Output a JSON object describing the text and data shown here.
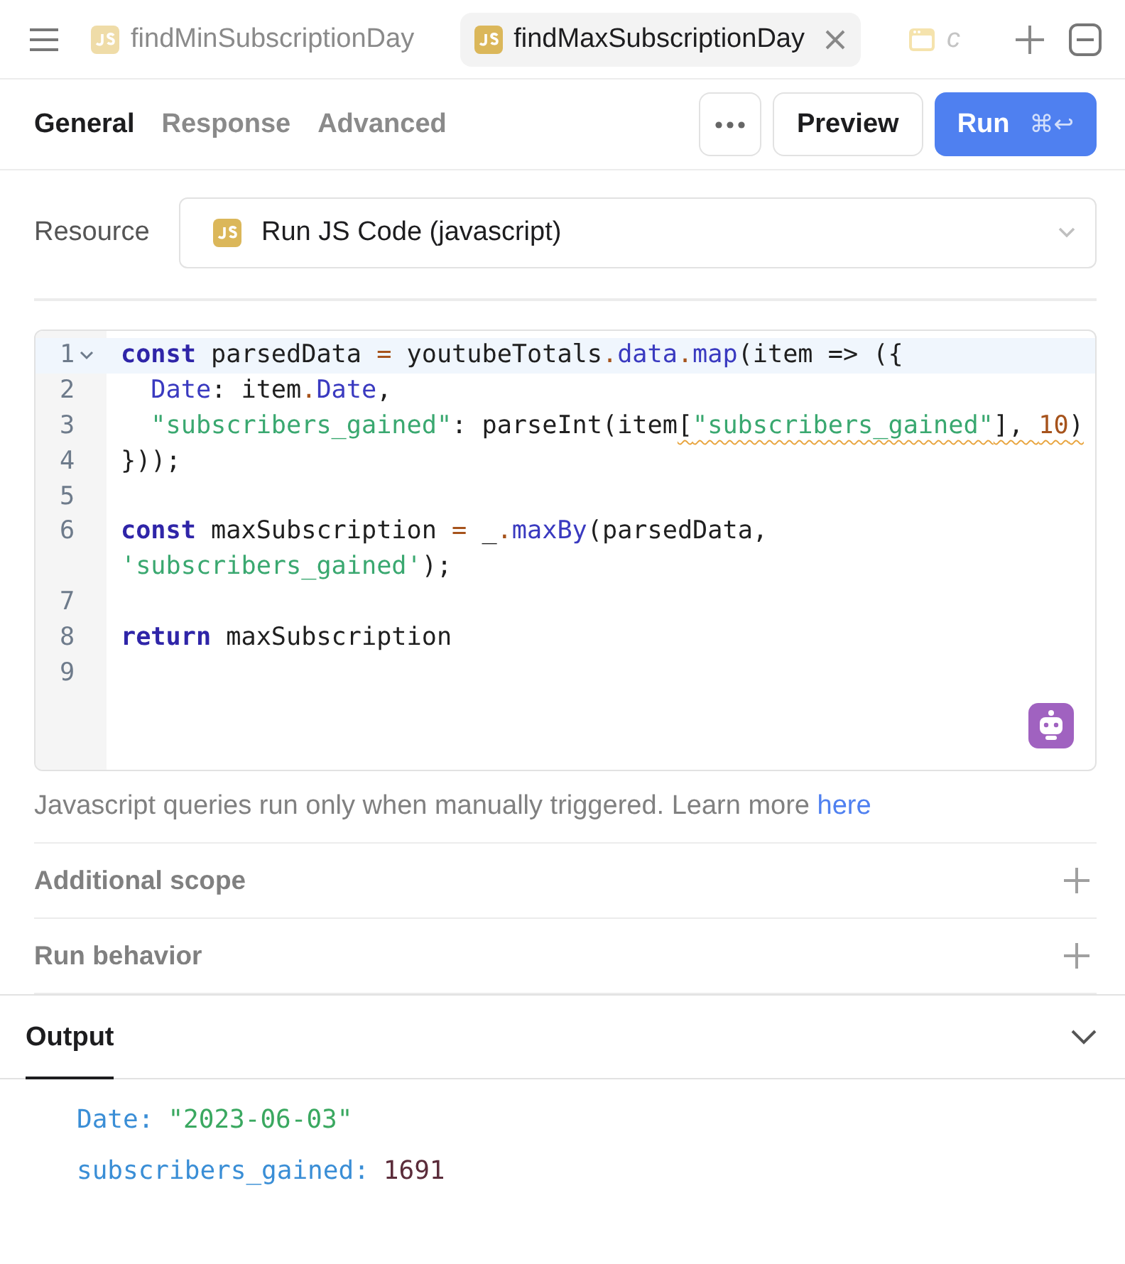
{
  "file_tabs": [
    {
      "label": "findMinSubscriptionDay",
      "kind": "js",
      "selected": false,
      "closable": false,
      "faded": false
    },
    {
      "label": "findMaxSubscriptionDay",
      "kind": "js",
      "selected": true,
      "closable": true,
      "faded": false
    },
    {
      "label": "c",
      "kind": "app",
      "selected": false,
      "closable": false,
      "faded": true
    }
  ],
  "section_tabs": [
    {
      "label": "General",
      "selected": true
    },
    {
      "label": "Response",
      "selected": false
    },
    {
      "label": "Advanced",
      "selected": false
    }
  ],
  "actions": {
    "preview": "Preview",
    "run": "Run",
    "run_shortcut": "⌘↩"
  },
  "resource": {
    "label": "Resource",
    "value": "Run JS Code (javascript)"
  },
  "code_lines": [
    {
      "number": "1",
      "active": true,
      "foldable": true,
      "rows": [
        [
          {
            "t": "const",
            "kind": "kw"
          },
          {
            "t": " parsedData ",
            "kind": "plain"
          },
          {
            "t": "=",
            "kind": "op"
          },
          {
            "t": " youtubeTotals",
            "kind": "plain"
          },
          {
            "t": ".",
            "kind": "op"
          },
          {
            "t": "data",
            "kind": "prop"
          },
          {
            "t": ".",
            "kind": "op"
          },
          {
            "t": "map",
            "kind": "prop"
          },
          {
            "t": "(item => ({",
            "kind": "plain"
          }
        ]
      ]
    },
    {
      "number": "2",
      "active": false,
      "foldable": false,
      "rows": [
        [
          {
            "t": "  Date",
            "kind": "prop"
          },
          {
            "t": ": item",
            "kind": "plain"
          },
          {
            "t": ".",
            "kind": "op"
          },
          {
            "t": "Date",
            "kind": "prop"
          },
          {
            "t": ",",
            "kind": "plain"
          }
        ]
      ]
    },
    {
      "number": "3",
      "active": false,
      "foldable": false,
      "rows": [
        [
          {
            "t": "  \"subscribers_gained\"",
            "kind": "str"
          },
          {
            "t": ": parseInt(item",
            "kind": "plain"
          },
          {
            "t": "[",
            "kind": "plain",
            "warning": true
          },
          {
            "t": "\"subscribers_gained\"",
            "kind": "str",
            "warning": true
          },
          {
            "t": "], ",
            "kind": "plain",
            "warning": true
          },
          {
            "t": "10",
            "kind": "num",
            "warning": true
          },
          {
            "t": ")",
            "kind": "plain",
            "warning": true
          }
        ]
      ]
    },
    {
      "number": "4",
      "active": false,
      "foldable": false,
      "rows": [
        [
          {
            "t": "}));",
            "kind": "plain"
          }
        ]
      ]
    },
    {
      "number": "5",
      "active": false,
      "foldable": false,
      "rows": [
        []
      ]
    },
    {
      "number": "6",
      "active": false,
      "foldable": false,
      "rows": [
        [
          {
            "t": "const",
            "kind": "kw"
          },
          {
            "t": " maxSubscription ",
            "kind": "plain"
          },
          {
            "t": "=",
            "kind": "op"
          },
          {
            "t": " _",
            "kind": "plain"
          },
          {
            "t": ".",
            "kind": "op"
          },
          {
            "t": "maxBy",
            "kind": "prop"
          },
          {
            "t": "(parsedData,",
            "kind": "plain"
          }
        ],
        [
          {
            "t": "'subscribers_gained'",
            "kind": "str"
          },
          {
            "t": ");",
            "kind": "plain"
          }
        ]
      ]
    },
    {
      "number": "7",
      "active": false,
      "foldable": false,
      "rows": [
        []
      ]
    },
    {
      "number": "8",
      "active": false,
      "foldable": false,
      "rows": [
        [
          {
            "t": "return",
            "kind": "kw"
          },
          {
            "t": " maxSubscription",
            "kind": "plain"
          }
        ]
      ]
    },
    {
      "number": "9",
      "active": false,
      "foldable": false,
      "rows": [
        []
      ]
    }
  ],
  "hint": {
    "text": "Javascript queries run only when manually triggered. Learn more",
    "link": "here"
  },
  "sections": [
    {
      "label": "Additional scope",
      "expanded": false
    },
    {
      "label": "Run behavior",
      "expanded": false
    }
  ],
  "output": {
    "tab": "Output",
    "expanded": true,
    "fields": [
      {
        "key": "Date:",
        "value": "\"2023-06-03\"",
        "kind": "string"
      },
      {
        "key": "subscribers_gained:",
        "value": "1691",
        "kind": "number"
      }
    ]
  }
}
